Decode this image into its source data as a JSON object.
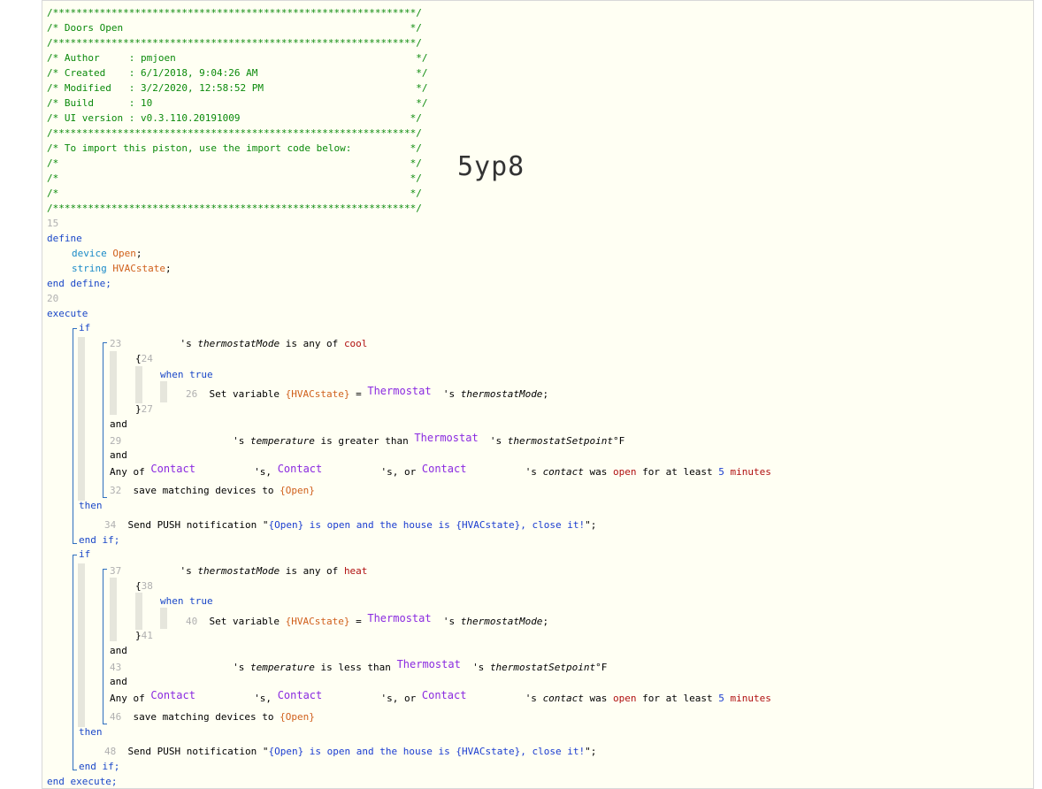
{
  "header": {
    "border_line": "/**************************************************************/",
    "title_line": "/* Doors Open                                                 */",
    "author_line": "/* Author     : pmjoen                                         */",
    "created_line": "/* Created    : 6/1/2018, 9:04:26 AM                           */",
    "modified_line": "/* Modified   : 3/2/2020, 12:58:52 PM                          */",
    "build_line": "/* Build      : 10                                             */",
    "ui_line": "/* UI version : v0.3.110.20191009                             */",
    "import_line": "/* To import this piston, use the import code below:          */",
    "blank_line": "/*                                                            */",
    "import_code": "5yp8"
  },
  "code": {
    "n15": "15",
    "n20": "20",
    "define": "define",
    "device": "device",
    "device_name": "Open",
    "string": "string",
    "string_name": "HVACstate",
    "end_define": "end define;",
    "execute": "execute",
    "if": "if",
    "then": "then",
    "end_if": "end if;",
    "and": "and",
    "end_execute": "end execute;",
    "s_mode": "'s",
    "thermostatMode": "thermostatMode",
    "is_any_of": "is any of",
    "cool": "cool",
    "heat": "heat",
    "open_brace": "{",
    "close_brace": "}",
    "when": "when",
    "true": "true",
    "set_variable": "Set variable",
    "hvac_var": "{HVACstate}",
    "eq": "=",
    "thermostat": "Thermostat",
    "s_mode_end": "'s thermostatMode;",
    "s_temp": "'s temperature",
    "greater": "is greater than",
    "less": "is less than",
    "setpoint": "'s thermostatSetpoint°F",
    "any_of": "Any of",
    "contact": "Contact",
    "s_comma": "'s,",
    "s_or": "'s, or",
    "s_contact": "'s",
    "contact_word": "contact",
    "was": "was",
    "open": "open",
    "for_at_least": "for at least",
    "five": "5",
    "minutes": "minutes",
    "save_matching": "save matching devices to",
    "open_var": "{Open}",
    "send_push": "Send PUSH notification \"",
    "push_msg": "{Open} is open and the house is {HVACstate}, close it!",
    "push_end": "\";",
    "ln23": "23",
    "ln24": "24",
    "ln26": "26",
    "ln27": "27",
    "ln29": "29",
    "ln32": "32",
    "ln34": "34",
    "ln37": "37",
    "ln38": "38",
    "ln40": "40",
    "ln41": "41",
    "ln43": "43",
    "ln46": "46",
    "ln48": "48"
  }
}
